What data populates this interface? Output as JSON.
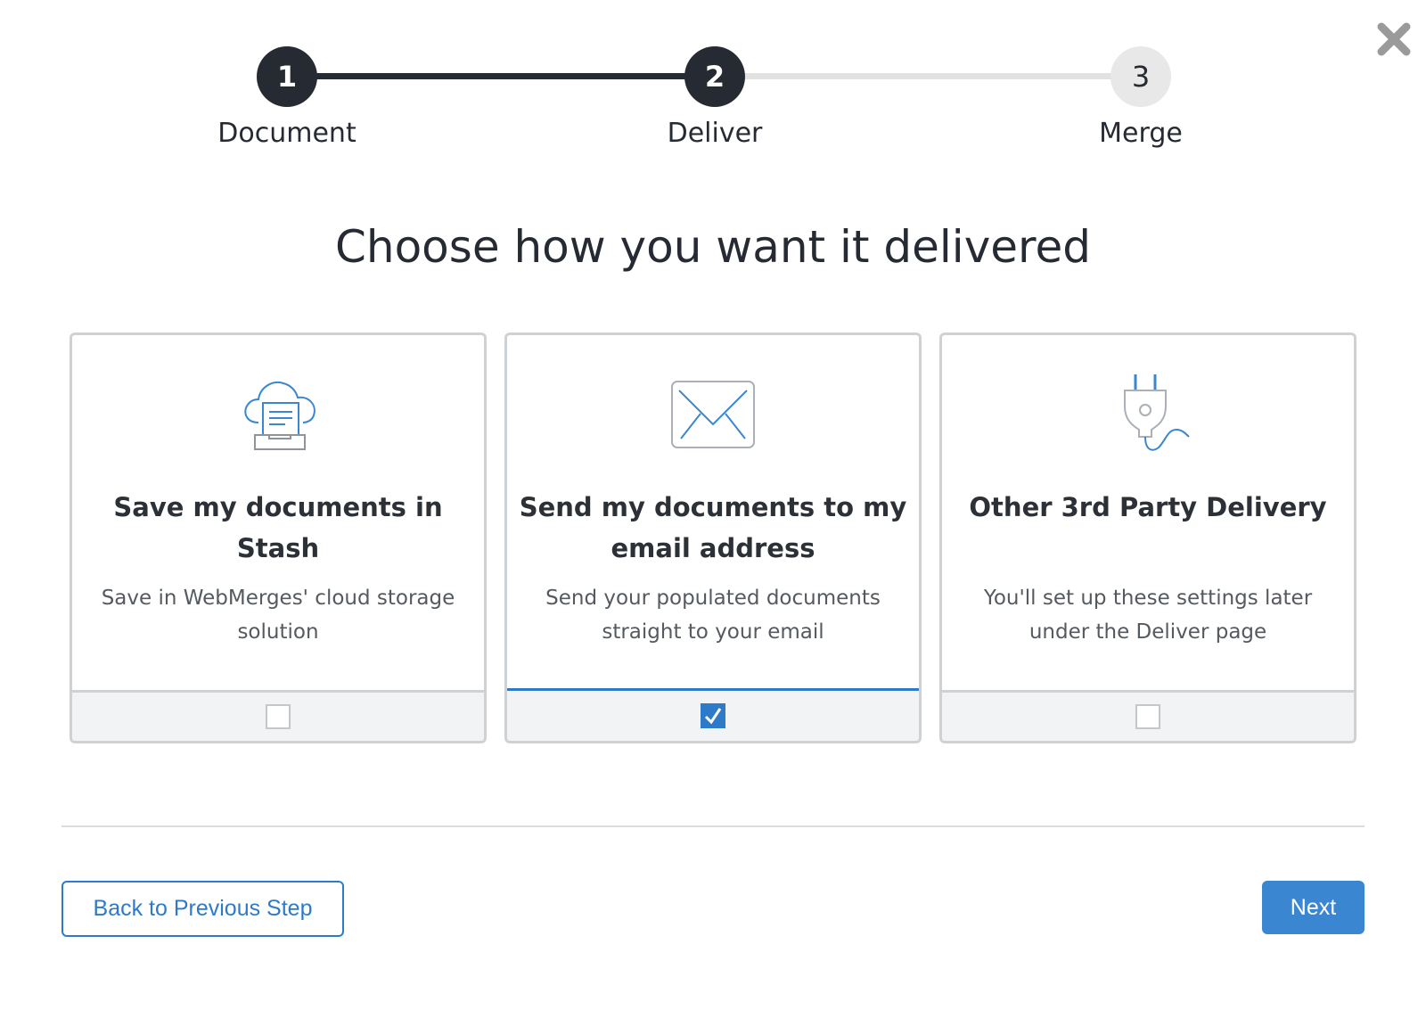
{
  "dialog": {
    "close_icon": "close-icon"
  },
  "stepper": {
    "steps": [
      {
        "number": "1",
        "label": "Document",
        "state": "done"
      },
      {
        "number": "2",
        "label": "Deliver",
        "state": "current"
      },
      {
        "number": "3",
        "label": "Merge",
        "state": "upcoming"
      }
    ]
  },
  "heading": "Choose how you want it delivered",
  "options": [
    {
      "icon": "cloud-storage-icon",
      "title": "Save my documents in Stash",
      "description": "Save in WebMerges' cloud storage solution",
      "checked": false
    },
    {
      "icon": "envelope-icon",
      "title": "Send my documents to my email address",
      "description": "Send your populated documents straight to your email",
      "checked": true
    },
    {
      "icon": "plug-icon",
      "title": "Other 3rd Party Delivery",
      "description": "You'll set up these settings later under the Deliver page",
      "checked": false
    }
  ],
  "footer": {
    "back_label": "Back to Previous Step",
    "next_label": "Next"
  },
  "colors": {
    "accent": "#2d7bc8",
    "dark": "#262b33",
    "icon_blue": "#3a87cf"
  }
}
